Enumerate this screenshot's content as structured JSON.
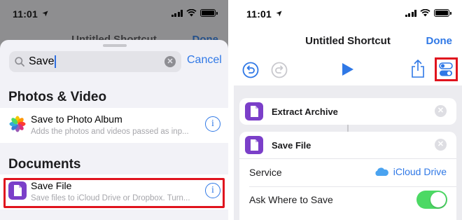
{
  "left_screen": {
    "status": {
      "time": "11:01"
    },
    "background": {
      "title": "Untitled Shortcut",
      "done": "Done"
    },
    "search": {
      "value": "Save",
      "clear_icon": "clear-circle-icon",
      "cancel_label": "Cancel"
    },
    "sections": [
      {
        "header": "Photos & Video",
        "items": [
          {
            "title": "Save to Photo Album",
            "subtitle": "Adds the photos and videos passed as inp...",
            "icon": "photos-icon"
          }
        ]
      },
      {
        "header": "Documents",
        "items": [
          {
            "title": "Save File",
            "subtitle": "Save files to iCloud Drive or Dropbox. Turn...",
            "icon": "file-icon",
            "highlighted": true
          }
        ]
      }
    ],
    "info_glyph": "i"
  },
  "right_screen": {
    "status": {
      "time": "11:01"
    },
    "nav": {
      "title": "Untitled Shortcut",
      "done": "Done"
    },
    "toolbar": {
      "undo_icon": "undo-icon",
      "redo_icon": "redo-icon",
      "play_icon": "play-icon",
      "share_icon": "share-icon",
      "settings_icon": "settings-toggle-icon",
      "settings_highlighted": true
    },
    "actions": [
      {
        "title": "Extract Archive",
        "icon": "file-icon"
      },
      {
        "title": "Save File",
        "icon": "file-icon",
        "params": [
          {
            "label": "Service",
            "value": "iCloud Drive",
            "icon": "icloud-icon"
          },
          {
            "label": "Ask Where to Save",
            "toggle": true
          }
        ]
      }
    ],
    "close_glyph": "✕"
  },
  "colors": {
    "accent": "#2f78e6",
    "highlight": "#e0141e",
    "action_icon": "#7b3fc9",
    "toggle_on": "#4cd964"
  }
}
